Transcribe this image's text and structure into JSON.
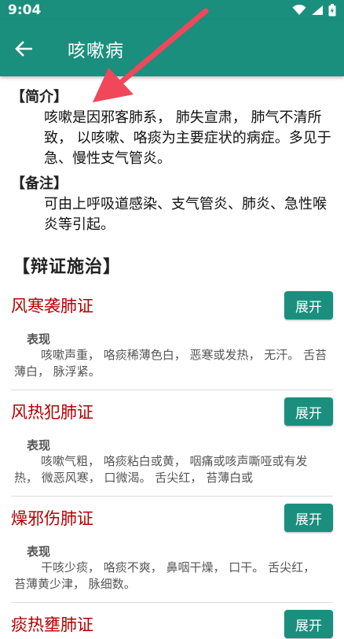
{
  "status": {
    "time": "9:04"
  },
  "appbar": {
    "title": "咳嗽病"
  },
  "intro": {
    "label": "【简介】",
    "text": "咳嗽是因邪客肺系， 肺失宣肃， 肺气不清所致， 以咳嗽、咯痰为主要症状的病症。多见于急、慢性支气管炎。"
  },
  "notes": {
    "label": "【备注】",
    "text": "可由上呼吸道感染、支气管炎、肺炎、急性喉炎等引起。"
  },
  "treatment_header": "【辩证施治】",
  "expand_label": "展开",
  "cards": [
    {
      "title": "风寒袭肺证",
      "sub_label": "表现",
      "text": "咳嗽声重， 咯痰稀薄色白， 恶寒或发热， 无汗。 舌苔薄白， 脉浮紧。"
    },
    {
      "title": "风热犯肺证",
      "sub_label": "表现",
      "text": "咳嗽气粗， 咯痰粘白或黄， 咽痛或咳声嘶哑或有发热， 微恶风寒， 口微渴。 舌尖红， 苔薄白或"
    },
    {
      "title": "燥邪伤肺证",
      "sub_label": "表现",
      "text": "干咳少痰， 咯痰不爽， 鼻咽干燥， 口干。 舌尖红， 苔薄黄少津， 脉细数。"
    },
    {
      "title": "痰热壅肺证"
    }
  ],
  "icons": [
    "wifi-icon",
    "signal-icon",
    "battery-icon",
    "back-arrow-icon",
    "red-annotation-arrow"
  ],
  "colors": {
    "primary": "#1a8f7d",
    "card_title": "#b40000",
    "annotation": "#f0475a"
  }
}
